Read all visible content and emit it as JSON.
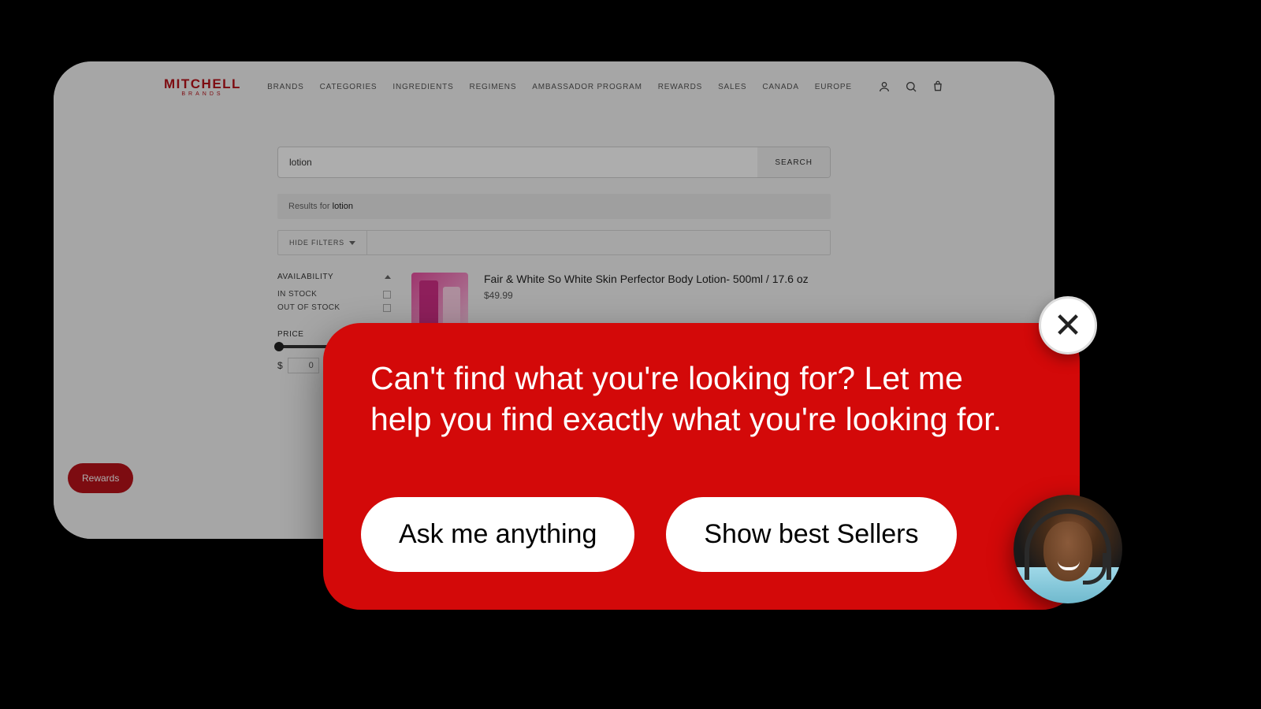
{
  "brand": {
    "main": "MITCHELL",
    "sub": "BRANDS"
  },
  "nav": {
    "items": [
      "BRANDS",
      "CATEGORIES",
      "INGREDIENTS",
      "REGIMENS",
      "AMBASSADOR PROGRAM",
      "REWARDS",
      "SALES",
      "CANADA",
      "EUROPE"
    ]
  },
  "search": {
    "value": "lotion",
    "button": "SEARCH",
    "results_prefix": "Results for ",
    "results_term": "lotion"
  },
  "filters": {
    "hide_label": "HIDE FILTERS",
    "availability": {
      "heading": "AVAILABILITY",
      "options": [
        "IN STOCK",
        "OUT OF STOCK"
      ]
    },
    "price": {
      "heading": "PRICE",
      "currency": "$",
      "min": "0"
    }
  },
  "product": {
    "title": "Fair & White So White Skin Perfector Body Lotion- 500ml / 17.6 oz",
    "price": "$49.99"
  },
  "rewards_pill": "Rewards",
  "popup": {
    "message": "Can't find what you're looking for? Let me help you find exactly what you're looking for.",
    "ask": "Ask me anything",
    "best": "Show best Sellers",
    "close_glyph": "✕"
  }
}
